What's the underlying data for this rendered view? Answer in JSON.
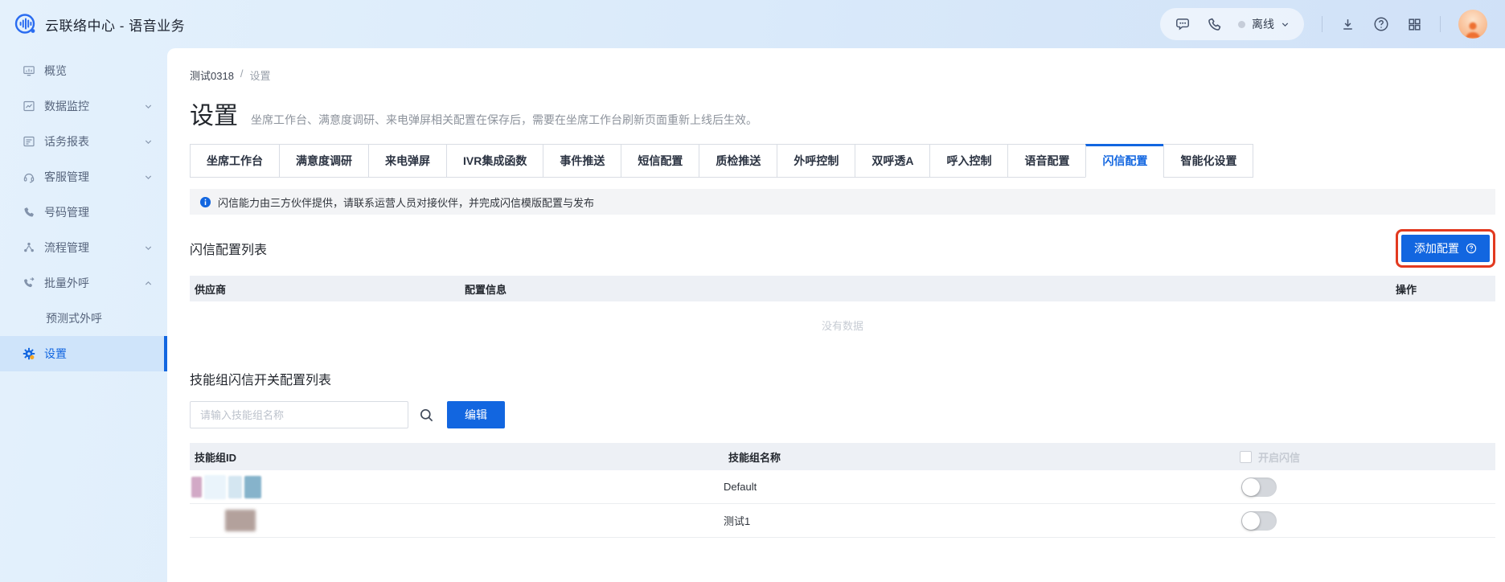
{
  "colors": {
    "primary_blue": "#1266e0",
    "chrome_background": "#d9e9fa",
    "selected_item_background": "#cfe4fa",
    "highlight_annotation_red": "#e23a20",
    "table_header_background": "#edf0f5",
    "banner_background": "#f3f4f6",
    "avatar_orange": "#ee7031",
    "status_dot_gray": "#c6cdd9"
  },
  "header": {
    "app_title": "云联络中心 - 语音业务",
    "status_label": "离线",
    "icons": [
      "voice-wave-logo",
      "chat-bubble-icon",
      "phone-handset-icon",
      "chevron-down-icon",
      "download-icon",
      "help-icon",
      "apps-grid-icon",
      "user-avatar"
    ]
  },
  "sidebar": {
    "items": [
      {
        "label": "概览"
      },
      {
        "label": "数据监控",
        "expandable": true
      },
      {
        "label": "话务报表",
        "expandable": true
      },
      {
        "label": "客服管理",
        "expandable": true
      },
      {
        "label": "号码管理"
      },
      {
        "label": "流程管理",
        "expandable": true
      },
      {
        "label": "批量外呼",
        "expandable": true,
        "expanded": true
      },
      {
        "label": "预测式外呼",
        "child": true
      },
      {
        "label": "设置",
        "selected": true
      }
    ]
  },
  "breadcrumb": {
    "items": [
      "测试0318",
      "设置"
    ],
    "separator": "/"
  },
  "page": {
    "title": "设置",
    "subtitle": "坐席工作台、满意度调研、来电弹屏相关配置在保存后，需要在坐席工作台刷新页面重新上线后生效。"
  },
  "tabs": [
    {
      "label": "坐席工作台"
    },
    {
      "label": "满意度调研"
    },
    {
      "label": "来电弹屏"
    },
    {
      "label": "IVR集成函数"
    },
    {
      "label": "事件推送"
    },
    {
      "label": "短信配置"
    },
    {
      "label": "质检推送"
    },
    {
      "label": "外呼控制"
    },
    {
      "label": "双呼透A"
    },
    {
      "label": "呼入控制"
    },
    {
      "label": "语音配置"
    },
    {
      "label": "闪信配置",
      "active": true
    },
    {
      "label": "智能化设置"
    }
  ],
  "banner": {
    "text": "闪信能力由三方伙伴提供，请联系运营人员对接伙伴，并完成闪信模版配置与发布"
  },
  "flash_config": {
    "title": "闪信配置列表",
    "add_button_label": "添加配置",
    "table": {
      "columns": [
        "供应商",
        "配置信息",
        "操作"
      ],
      "empty_text": "没有数据",
      "rows": []
    }
  },
  "skill_group": {
    "title": "技能组闪信开关配置列表",
    "search_placeholder": "请输入技能组名称",
    "edit_button_label": "编辑",
    "table": {
      "columns": [
        "技能组ID",
        "技能组名称",
        "开启闪信"
      ],
      "header_checkbox_checked": false,
      "rows": [
        {
          "id_redacted": true,
          "name": "Default",
          "flash_enabled": false
        },
        {
          "id_redacted": true,
          "name": "测试1",
          "flash_enabled": false
        }
      ]
    }
  }
}
